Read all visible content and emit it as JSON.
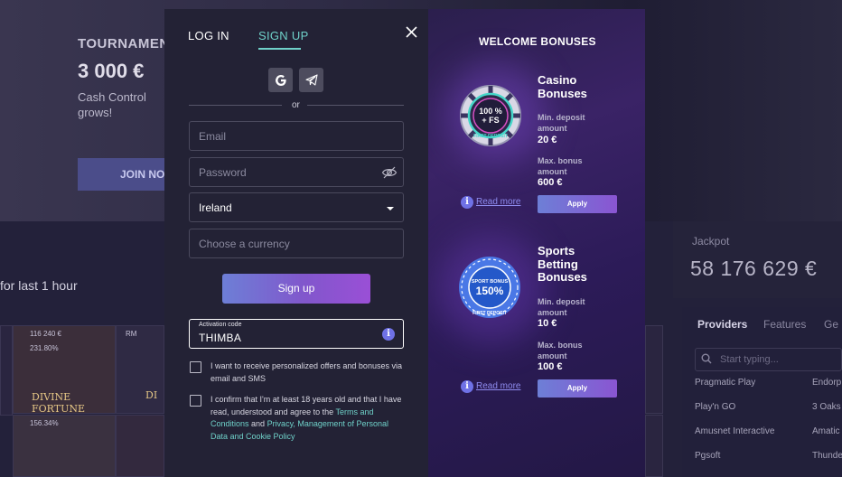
{
  "background": {
    "tournament_title": "TOURNAMEN",
    "tournament_amount": "3 000 €",
    "tournament_desc": "Cash Control grows!",
    "join_label": "JOIN NO",
    "last_hour": "for last 1 hour",
    "tiles": [
      {
        "label": "116 240 €"
      },
      {
        "label": "231.80%"
      },
      {
        "label": "156.34%"
      }
    ],
    "tile_titles": [
      "DIVINE FORTUNE",
      "DI"
    ],
    "jackpot_label": "Jackpot",
    "jackpot_amount": "58 176 629 €",
    "tabs": [
      "Providers",
      "Features",
      "Ge"
    ],
    "search_placeholder": "Start typing...",
    "providers_left": [
      "Pragmatic Play",
      "Play'n GO",
      "Amusnet Interactive",
      "Pgsoft"
    ],
    "providers_right": [
      "Endorp",
      "3 Oaks",
      "Amatic",
      "Thunde"
    ]
  },
  "modal": {
    "tabs": {
      "login": "LOG IN",
      "signup": "SIGN UP"
    },
    "social": {
      "google_icon": "google-icon",
      "telegram_icon": "telegram-icon"
    },
    "or_text": "or",
    "email_placeholder": "Email",
    "password_placeholder": "Password",
    "country_value": "Ireland",
    "currency_placeholder": "Choose a currency",
    "signup_button": "Sign up",
    "activation_label": "Activation code",
    "activation_value": "THIMBA",
    "consent_offers": "I want to receive personalized offers and bonuses via email and SMS",
    "consent_age_prefix": "I confirm that I'm at least 18 years old and that I have read, understood and agree to the ",
    "consent_terms_link": "Terms and Conditions",
    "consent_and": " and ",
    "consent_privacy_link": "Privacy, Management of Personal Data and Cookie Policy",
    "accent_color": "#6fd1c9"
  },
  "bonuses": {
    "title": "WELCOME BONUSES",
    "items": [
      {
        "title_line1": "Casino",
        "title_line2": "Bonuses",
        "title_line3": "",
        "chip_text1": "100 %",
        "chip_text2": "+ FS",
        "chip_ring": "FIRST DEPOSIT",
        "min_label": "Min. deposit amount",
        "min_value": "20 €",
        "max_label": "Max. bonus amount",
        "max_value": "600 €",
        "read_more": "Read more",
        "apply": "Apply"
      },
      {
        "title_line1": "Sports",
        "title_line2": "Betting",
        "title_line3": "Bonuses",
        "chip_text1": "SPORT BONUS",
        "chip_text2": "150%",
        "chip_ring": "FIRST DEPOSIT",
        "min_label": "Min. deposit amount",
        "min_value": "10 €",
        "max_label": "Max. bonus amount",
        "max_value": "100 €",
        "read_more": "Read more",
        "apply": "Apply"
      }
    ]
  }
}
